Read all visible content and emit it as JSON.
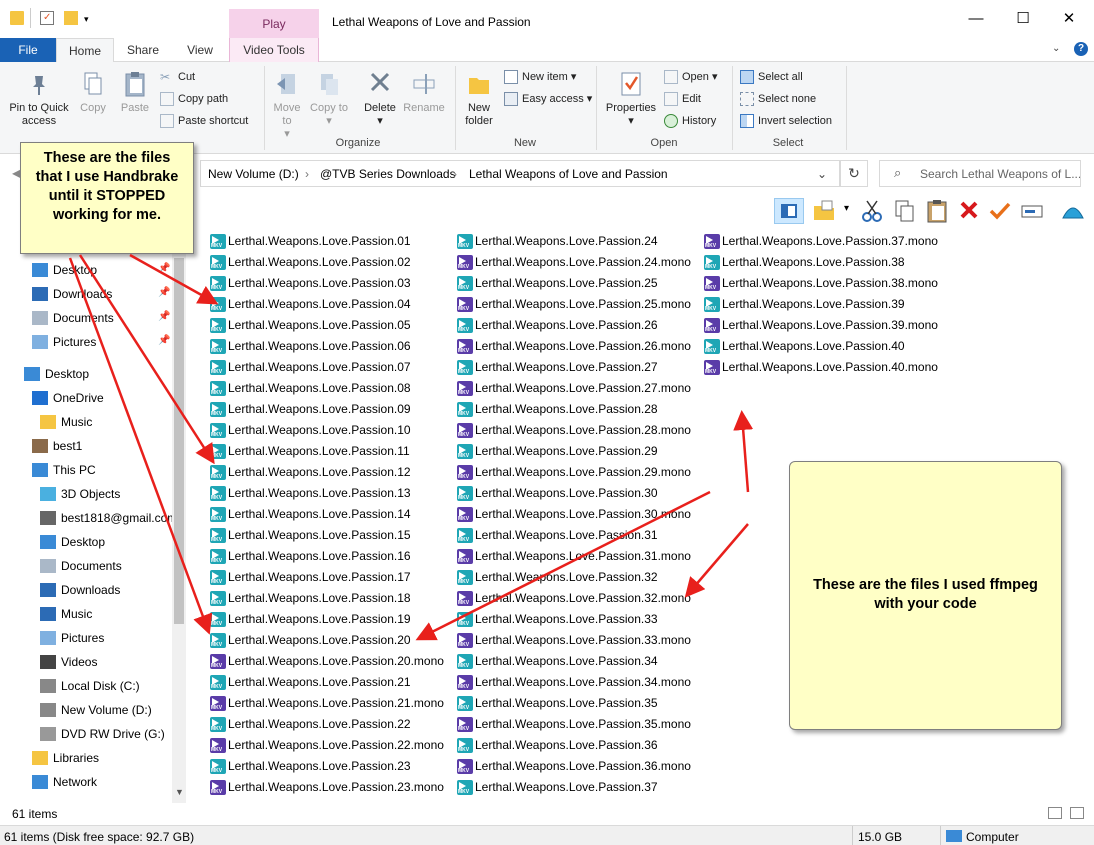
{
  "window": {
    "title": "Lethal Weapons of Love and Passion",
    "context_tab": "Play",
    "context_sub_tab": "Video Tools",
    "controls": [
      "—",
      "☐",
      "✕"
    ]
  },
  "tabs": [
    "File",
    "Home",
    "Share",
    "View",
    "Video Tools"
  ],
  "ribbon": {
    "clipboard": {
      "pin": "Pin to Quick access",
      "copy": "Copy",
      "paste": "Paste",
      "cut": "Cut",
      "copy_path": "Copy path",
      "paste_shortcut": "Paste shortcut"
    },
    "organize": {
      "move_to": "Move to",
      "copy_to": "Copy to",
      "delete": "Delete",
      "rename": "Rename",
      "label": "Organize"
    },
    "new": {
      "new_folder": "New folder",
      "new_item": "New item",
      "easy_access": "Easy access",
      "label": "New"
    },
    "open": {
      "properties": "Properties",
      "open": "Open",
      "edit": "Edit",
      "history": "History",
      "label": "Open"
    },
    "select": {
      "select_all": "Select all",
      "select_none": "Select none",
      "invert": "Invert selection",
      "label": "Select"
    }
  },
  "address": {
    "crumbs": [
      "New Volume (D:)",
      "@TVB Series Downloads",
      "Lethal Weapons of Love and Passion"
    ],
    "search_placeholder": "Search Lethal Weapons of L..."
  },
  "nav": [
    {
      "label": "Desktop",
      "icon": "desktop-icon"
    },
    {
      "label": "Downloads",
      "icon": "downloads-icon"
    },
    {
      "label": "Documents",
      "icon": "documents-icon"
    },
    {
      "label": "Pictures",
      "icon": "pictures-icon"
    },
    {
      "label": "Desktop",
      "icon": "desktop-icon"
    },
    {
      "label": "OneDrive",
      "icon": "onedrive-icon"
    },
    {
      "label": "Music",
      "icon": "folder-icon"
    },
    {
      "label": "best1",
      "icon": "user-icon"
    },
    {
      "label": "This PC",
      "icon": "pc-icon"
    },
    {
      "label": "3D Objects",
      "icon": "3d-objects-icon"
    },
    {
      "label": "best1818@gmail.com",
      "icon": "phone-icon"
    },
    {
      "label": "Desktop",
      "icon": "desktop-icon"
    },
    {
      "label": "Documents",
      "icon": "documents-icon"
    },
    {
      "label": "Downloads",
      "icon": "downloads-icon"
    },
    {
      "label": "Music",
      "icon": "music-icon"
    },
    {
      "label": "Pictures",
      "icon": "pictures-icon"
    },
    {
      "label": "Videos",
      "icon": "videos-icon"
    },
    {
      "label": "Local Disk (C:)",
      "icon": "drive-icon"
    },
    {
      "label": "New Volume (D:)",
      "icon": "drive-icon"
    },
    {
      "label": "DVD RW Drive (G:)",
      "icon": "dvd-icon"
    },
    {
      "label": "Libraries",
      "icon": "libraries-icon"
    },
    {
      "label": "Network",
      "icon": "network-icon"
    }
  ],
  "files": {
    "col1": [
      "Lerthal.Weapons.Love.Passion.01",
      "Lerthal.Weapons.Love.Passion.02",
      "Lerthal.Weapons.Love.Passion.03",
      "Lerthal.Weapons.Love.Passion.04",
      "Lerthal.Weapons.Love.Passion.05",
      "Lerthal.Weapons.Love.Passion.06",
      "Lerthal.Weapons.Love.Passion.07",
      "Lerthal.Weapons.Love.Passion.08",
      "Lerthal.Weapons.Love.Passion.09",
      "Lerthal.Weapons.Love.Passion.10",
      "Lerthal.Weapons.Love.Passion.11",
      "Lerthal.Weapons.Love.Passion.12",
      "Lerthal.Weapons.Love.Passion.13",
      "Lerthal.Weapons.Love.Passion.14",
      "Lerthal.Weapons.Love.Passion.15",
      "Lerthal.Weapons.Love.Passion.16",
      "Lerthal.Weapons.Love.Passion.17",
      "Lerthal.Weapons.Love.Passion.18",
      "Lerthal.Weapons.Love.Passion.19",
      "Lerthal.Weapons.Love.Passion.20",
      "Lerthal.Weapons.Love.Passion.20.mono",
      "Lerthal.Weapons.Love.Passion.21",
      "Lerthal.Weapons.Love.Passion.21.mono",
      "Lerthal.Weapons.Love.Passion.22",
      "Lerthal.Weapons.Love.Passion.22.mono",
      "Lerthal.Weapons.Love.Passion.23",
      "Lerthal.Weapons.Love.Passion.23.mono"
    ],
    "col2": [
      "Lerthal.Weapons.Love.Passion.24",
      "Lerthal.Weapons.Love.Passion.24.mono",
      "Lerthal.Weapons.Love.Passion.25",
      "Lerthal.Weapons.Love.Passion.25.mono",
      "Lerthal.Weapons.Love.Passion.26",
      "Lerthal.Weapons.Love.Passion.26.mono",
      "Lerthal.Weapons.Love.Passion.27",
      "Lerthal.Weapons.Love.Passion.27.mono",
      "Lerthal.Weapons.Love.Passion.28",
      "Lerthal.Weapons.Love.Passion.28.mono",
      "Lerthal.Weapons.Love.Passion.29",
      "Lerthal.Weapons.Love.Passion.29.mono",
      "Lerthal.Weapons.Love.Passion.30",
      "Lerthal.Weapons.Love.Passion.30.mono",
      "Lerthal.Weapons.Love.Passion.31",
      "Lerthal.Weapons.Love.Passion.31.mono",
      "Lerthal.Weapons.Love.Passion.32",
      "Lerthal.Weapons.Love.Passion.32.mono",
      "Lerthal.Weapons.Love.Passion.33",
      "Lerthal.Weapons.Love.Passion.33.mono",
      "Lerthal.Weapons.Love.Passion.34",
      "Lerthal.Weapons.Love.Passion.34.mono",
      "Lerthal.Weapons.Love.Passion.35",
      "Lerthal.Weapons.Love.Passion.35.mono",
      "Lerthal.Weapons.Love.Passion.36",
      "Lerthal.Weapons.Love.Passion.36.mono",
      "Lerthal.Weapons.Love.Passion.37"
    ],
    "col3": [
      "Lerthal.Weapons.Love.Passion.37.mono",
      "Lerthal.Weapons.Love.Passion.38",
      "Lerthal.Weapons.Love.Passion.38.mono",
      "Lerthal.Weapons.Love.Passion.39",
      "Lerthal.Weapons.Love.Passion.39.mono",
      "Lerthal.Weapons.Love.Passion.40",
      "Lerthal.Weapons.Love.Passion.40.mono"
    ]
  },
  "callouts": {
    "handbrake": "These are the files that I use Handbrake until it STOPPED working for me.",
    "ffmpeg": "These are the files I used ffmpeg with your code"
  },
  "status": {
    "items": "61 items",
    "bottom_left": "61 items (Disk free space: 92.7 GB)",
    "size": "15.0 GB",
    "location": "Computer"
  },
  "colors": {
    "accent": "#1a62b5",
    "play_tab": "#f6d2ea",
    "note_bg": "#ffffc6",
    "arrow": "#e8201c"
  }
}
